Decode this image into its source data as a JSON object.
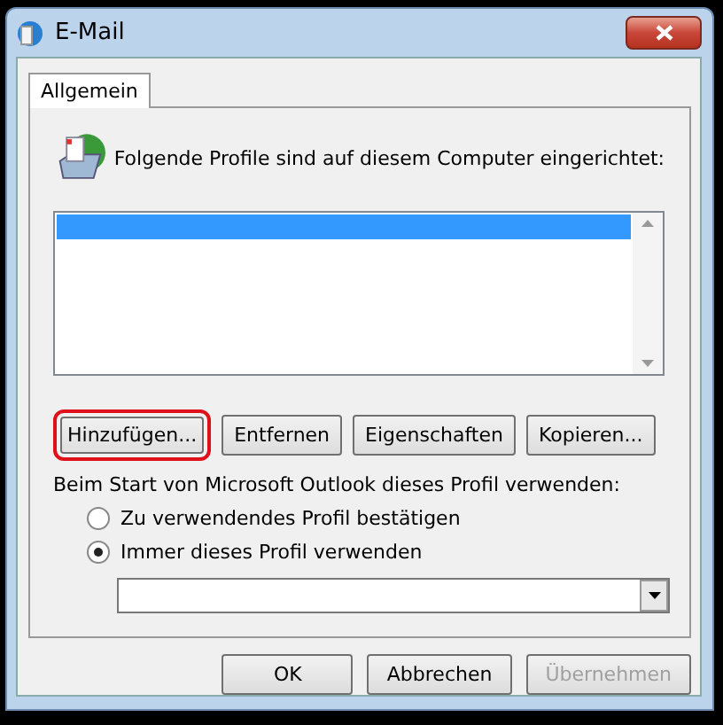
{
  "window": {
    "title": "E-Mail"
  },
  "tabs": [
    {
      "label": "Allgemein",
      "selected": true
    }
  ],
  "intro": "Folgende Profile sind auf diesem Computer eingerichtet:",
  "profiles": [
    {
      "selected": true
    }
  ],
  "profile_buttons": [
    {
      "label": "Hinzufügen...",
      "highlighted": true
    },
    {
      "label": "Entfernen",
      "highlighted": false
    },
    {
      "label": "Eigenschaften",
      "highlighted": false
    },
    {
      "label": "Kopieren...",
      "highlighted": false
    }
  ],
  "startup_label": "Beim Start von Microsoft Outlook dieses Profil verwenden:",
  "startup_options": [
    {
      "label": "Zu verwendendes Profil bestätigen",
      "selected": false
    },
    {
      "label": "Immer dieses Profil verwenden",
      "selected": true
    }
  ],
  "dialog_buttons": [
    {
      "label": "OK",
      "disabled": false
    },
    {
      "label": "Abbrechen",
      "disabled": false
    },
    {
      "label": "Übernehmen",
      "disabled": true
    }
  ]
}
